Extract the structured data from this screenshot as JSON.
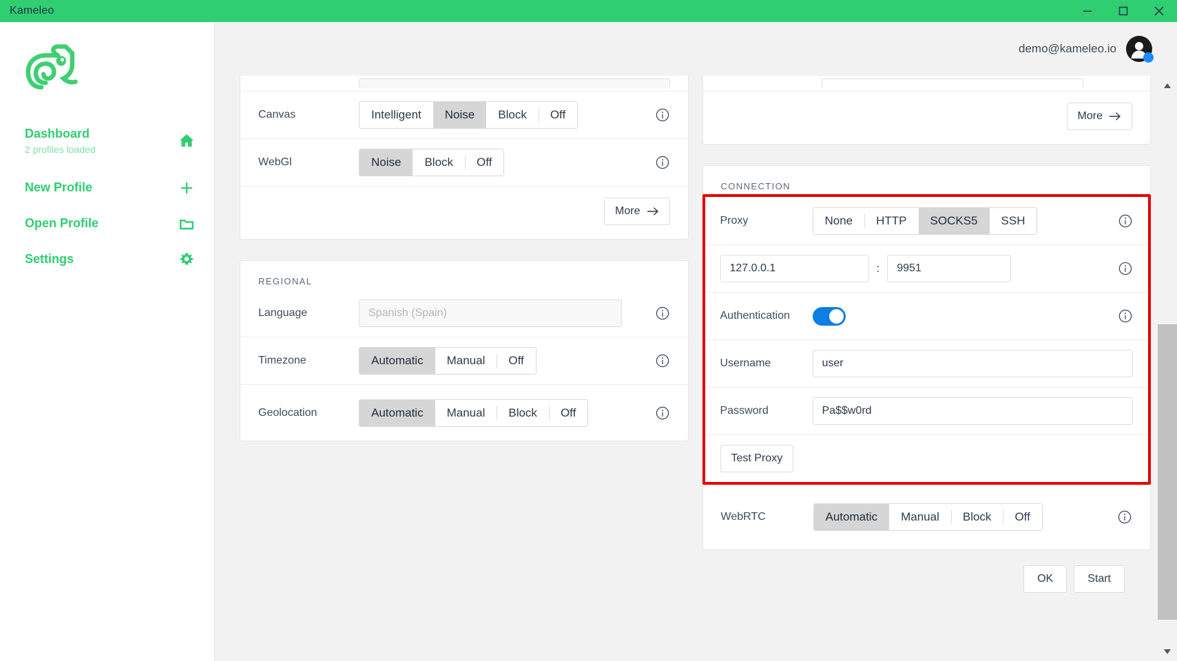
{
  "window": {
    "title": "Kameleo",
    "minimize_icon": "minimize-icon",
    "maximize_icon": "maximize-icon",
    "close_icon": "close-icon"
  },
  "sidebar": {
    "logo": "kameleo-chameleon-logo",
    "items": [
      {
        "label": "Dashboard",
        "sub": "2 profiles loaded",
        "icon": "home-icon"
      },
      {
        "label": "New Profile",
        "sub": "",
        "icon": "plus-icon"
      },
      {
        "label": "Open Profile",
        "sub": "",
        "icon": "folder-icon"
      },
      {
        "label": "Settings",
        "sub": "",
        "icon": "gear-icon"
      }
    ]
  },
  "topbar": {
    "email": "demo@kameleo.io",
    "avatar": "user-avatar",
    "status": "online"
  },
  "left_column": {
    "fingerprint_card": {
      "rows": [
        {
          "label": "Canvas",
          "options": [
            "Intelligent",
            "Noise",
            "Block",
            "Off"
          ],
          "selected": "Noise"
        },
        {
          "label": "WebGl",
          "options": [
            "Noise",
            "Block",
            "Off"
          ],
          "selected": "Noise"
        }
      ],
      "more_label": "More"
    },
    "regional_card": {
      "title": "REGIONAL",
      "language": {
        "label": "Language",
        "value": "",
        "placeholder": "Spanish (Spain)"
      },
      "rows": [
        {
          "label": "Timezone",
          "options": [
            "Automatic",
            "Manual",
            "Off"
          ],
          "selected": "Automatic"
        },
        {
          "label": "Geolocation",
          "options": [
            "Automatic",
            "Manual",
            "Block",
            "Off"
          ],
          "selected": "Automatic"
        }
      ]
    }
  },
  "right_column": {
    "top_card": {
      "more_label": "More"
    },
    "connection_card": {
      "title": "CONNECTION",
      "proxy": {
        "label": "Proxy",
        "options": [
          "None",
          "HTTP",
          "SOCKS5",
          "SSH"
        ],
        "selected": "SOCKS5"
      },
      "host": {
        "value": "127.0.0.1",
        "placeholder": ""
      },
      "separator": ":",
      "port": {
        "value": "9951",
        "placeholder": ""
      },
      "authentication": {
        "label": "Authentication",
        "enabled": true
      },
      "username": {
        "label": "Username",
        "value": "user",
        "placeholder": ""
      },
      "password": {
        "label": "Password",
        "value": "Pa$$w0rd",
        "placeholder": ""
      },
      "test_proxy_label": "Test Proxy",
      "webrtc": {
        "label": "WebRTC",
        "options": [
          "Automatic",
          "Manual",
          "Block",
          "Off"
        ],
        "selected": "Automatic"
      },
      "highlight_color": "#e60000"
    }
  },
  "footer": {
    "ok_label": "OK",
    "start_label": "Start"
  },
  "colors": {
    "brand_green": "#2ece71",
    "toggle_blue": "#0d7fe0",
    "highlight_red": "#e60000",
    "text_dark": "#2c3a4b"
  }
}
